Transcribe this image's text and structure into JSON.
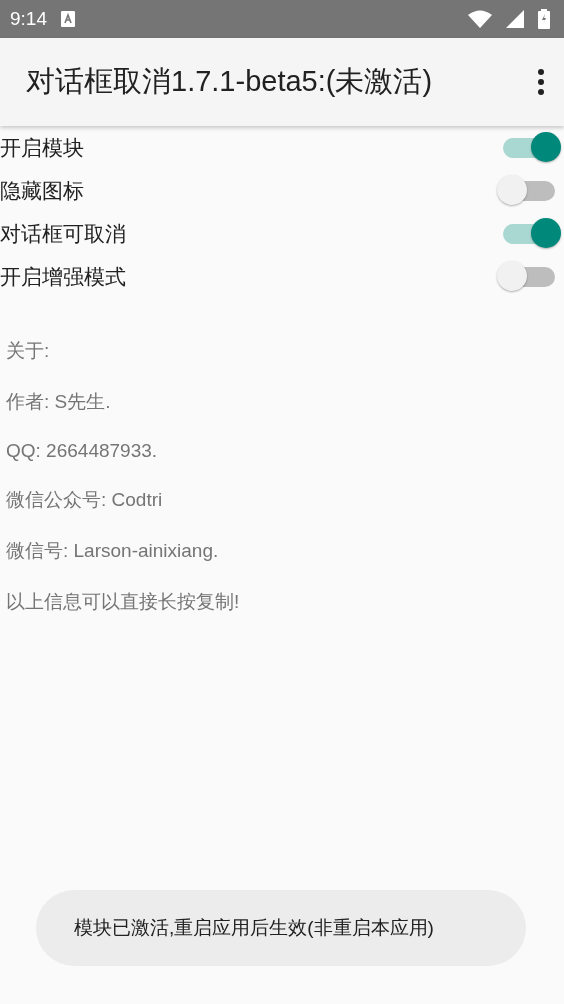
{
  "status_bar": {
    "time": "9:14"
  },
  "app_bar": {
    "title": "对话框取消1.7.1-beta5:(未激活)"
  },
  "switches": [
    {
      "label": "开启模块",
      "on": true
    },
    {
      "label": "隐藏图标",
      "on": false
    },
    {
      "label": "对话框可取消",
      "on": true
    },
    {
      "label": "开启增强模式",
      "on": false
    }
  ],
  "about_lines": [
    "关于:",
    "作者: S先生.",
    "QQ: 2664487933.",
    "微信公众号: Codtri",
    "微信号: Larson-ainixiang.",
    "以上信息可以直接长按复制!"
  ],
  "toast": "模块已激活,重启应用后生效(非重启本应用)"
}
